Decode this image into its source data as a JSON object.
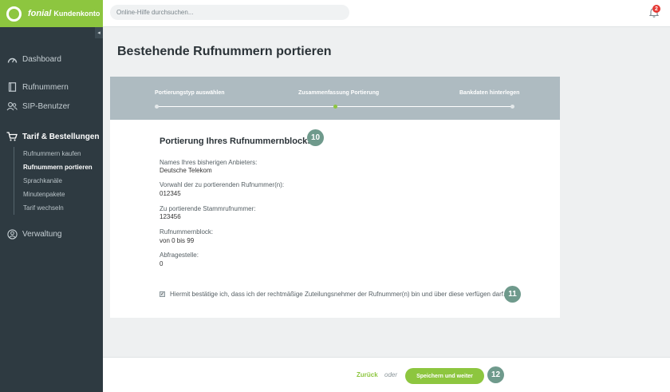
{
  "brand": {
    "name": "fonial",
    "subtitle": "Kundenkonto"
  },
  "search": {
    "placeholder": "Online-Hilfe durchsuchen..."
  },
  "notifications": {
    "count": "2"
  },
  "sidebar": {
    "collapse_glyph": "◂",
    "items": [
      {
        "label": "Dashboard",
        "icon": "dashboard-icon"
      },
      {
        "label": "Rufnummern",
        "icon": "phone-book-icon"
      },
      {
        "label": "SIP-Benutzer",
        "icon": "users-icon"
      },
      {
        "label": "Tarif & Bestellungen",
        "icon": "cart-icon",
        "active": true
      },
      {
        "label": "Verwaltung",
        "icon": "user-circle-icon"
      }
    ],
    "submenu": [
      {
        "label": "Rufnummern kaufen"
      },
      {
        "label": "Rufnummern portieren",
        "active": true
      },
      {
        "label": "Sprachkanäle"
      },
      {
        "label": "Minutenpakete"
      },
      {
        "label": "Tarif wechseln"
      }
    ]
  },
  "page": {
    "title": "Bestehende Rufnummern portieren"
  },
  "stepper": {
    "steps": [
      {
        "label": "Portierungstyp auswählen"
      },
      {
        "label": "Zusammenfassung Portierung",
        "current": true
      },
      {
        "label": "Bankdaten hinterlegen"
      }
    ]
  },
  "summary": {
    "title": "Portierung Ihres Rufnummernblocks",
    "fields": [
      {
        "label": "Names Ihres bisherigen Anbieters:",
        "value": "Deutsche Telekom"
      },
      {
        "label": "Vorwahl der zu portierenden Rufnummer(n):",
        "value": "012345"
      },
      {
        "label": "Zu portierende Stammrufnummer:",
        "value": "123456"
      },
      {
        "label": "Rufnummernblock:",
        "value": "von 0 bis 99"
      },
      {
        "label": "Abfragestelle:",
        "value": "0"
      }
    ],
    "confirm_text": "Hiermit bestätige ich, dass ich der rechtmäßige Zuteilungsnehmer der Rufnummer(n) bin und über diese verfügen darf.",
    "confirm_checked": true,
    "checkmark": "✓"
  },
  "markers": {
    "summary": "10",
    "confirm": "11",
    "save": "12"
  },
  "footer": {
    "back_label": "Zurück",
    "or_label": "oder",
    "save_label": "Speichern und weiter"
  },
  "colors": {
    "accent": "#8dc63f",
    "sidebar": "#2e3a41",
    "stepper": "#aebbc1",
    "marker": "#6f9a8c",
    "badge": "#e53935"
  }
}
